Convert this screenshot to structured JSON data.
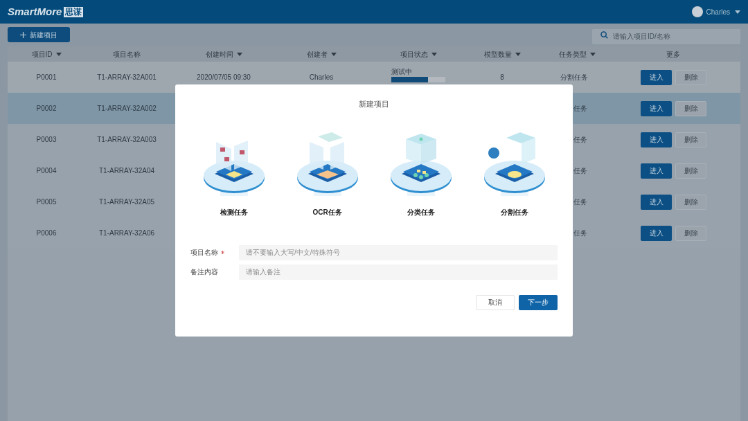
{
  "header": {
    "logo_text": "SmartMore",
    "logo_badge": "思谋",
    "user": "Charles"
  },
  "toolbar": {
    "new_button": "新建项目",
    "search": {
      "placeholder": "请输入项目ID/名称"
    }
  },
  "table": {
    "columns": [
      {
        "label": "项目ID",
        "sortable": true
      },
      {
        "label": "项目名称",
        "sortable": false
      },
      {
        "label": "创建时间",
        "sortable": true
      },
      {
        "label": "创建者",
        "sortable": true
      },
      {
        "label": "项目状态",
        "sortable": true
      },
      {
        "label": "模型数量",
        "sortable": true
      },
      {
        "label": "任务类型",
        "sortable": true
      },
      {
        "label": "更多",
        "sortable": false
      }
    ],
    "rows": [
      {
        "id": "P0001",
        "name": "T1-ARRAY-32A001",
        "created": "2020/07/05  09:30",
        "creator": "Charles",
        "status": {
          "label": "测试中",
          "level": 0.68
        },
        "models": "8",
        "task_type": "分割任务",
        "enter": "进入",
        "delete": "删除",
        "selected": false
      },
      {
        "id": "P0002",
        "name": "T1-ARRAY-32A002",
        "task_type": "任务",
        "enter": "进入",
        "delete": "删除",
        "selected": true
      },
      {
        "id": "P0003",
        "name": "T1-ARRAY-32A003",
        "task_type": "任务",
        "enter": "进入",
        "delete": "删除",
        "selected": false
      },
      {
        "id": "P0004",
        "name": "T1-ARRAY-32A04",
        "task_type": "任务",
        "enter": "进入",
        "delete": "删除",
        "selected": false
      },
      {
        "id": "P0005",
        "name": "T1-ARRAY-32A05",
        "task_type": "任务",
        "enter": "进入",
        "delete": "删除",
        "selected": false
      },
      {
        "id": "P0006",
        "name": "T1-ARRAY-32A06",
        "task_type": "任务",
        "enter": "进入",
        "delete": "删除",
        "selected": false
      }
    ]
  },
  "dialog": {
    "title": "新建项目",
    "task_types": [
      {
        "kind": "detection",
        "label": "检测任务"
      },
      {
        "kind": "ocr",
        "label": "OCR任务"
      },
      {
        "kind": "classification",
        "label": "分类任务"
      },
      {
        "kind": "segmentation",
        "label": "分割任务"
      }
    ],
    "fields": [
      {
        "label": "项目名称",
        "required": true,
        "placeholder": "请不要输入大写/中文/特殊符号"
      },
      {
        "label": "备注内容",
        "required": false,
        "placeholder": "请输入备注"
      }
    ],
    "cancel": "取消",
    "next": "下一步"
  }
}
